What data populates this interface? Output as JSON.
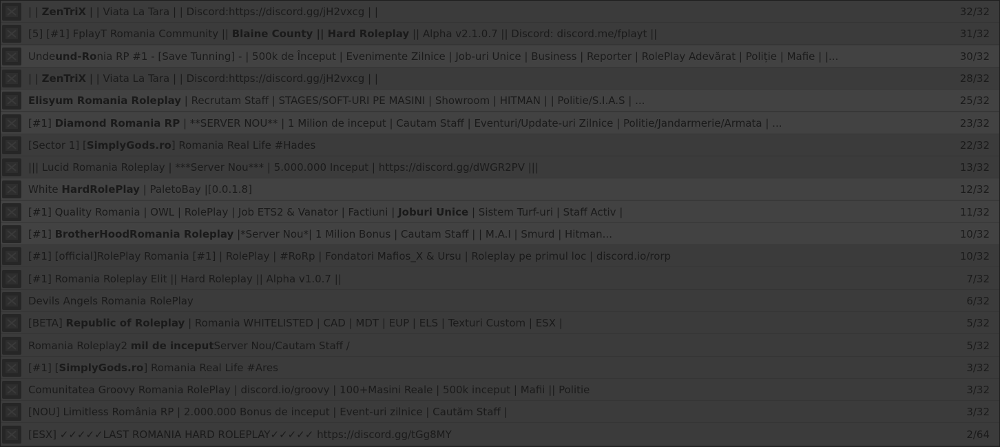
{
  "servers": [
    {
      "name_a": "| | ",
      "name_b": "ZenTriX",
      "name_c": " | | Viata La Tara | | Discord:https://discord.gg/jH2vxcg | |",
      "players": "32/32",
      "icon": "x-logo-icon"
    },
    {
      "name_a": "[5] [#1] FplayT Romania Community || ",
      "name_b": "Blaine County || Hard Roleplay",
      "name_c": " || Alpha v2.1.0.7 || Discord: discord.me/fplayt ||",
      "players": "31/32",
      "icon": "server-logo-icon"
    },
    {
      "name_a": "Unde",
      "name_b": "und-Ro",
      "name_c": "nia RP #1 - [Save Tunning] - | 500k de Început | Evenimente Zilnice | Job-uri Unice | Business | Reporter | RolePlay Adevărat | Poliție | Mafie |        |...",
      "players": "30/32",
      "icon": "circle-logo-icon"
    },
    {
      "name_a": "| | ",
      "name_b": "ZenTriX",
      "name_c": " | | Viata La Tara | | Discord:https://discord.gg/jH2vxcg | |",
      "players": "28/32",
      "icon": "x-logo-icon"
    },
    {
      "name_a": "",
      "name_b": "Elisyum Romania Roleplay",
      "name_c": " | Recrutam Staff | STAGES/SOFT-URI PE MASINI | Showroom | HITMAN | | Politie/S.I.A.S | ...",
      "players": "25/32",
      "icon": "server-logo-icon"
    },
    {
      "name_a": "[#1] ",
      "name_b": "Diamond Romania RP",
      "name_c": " | **SERVER NOU** | 1 Milion de inceput | Cautam Staff | Eventuri/Update-uri Zilnice | Politie/Jandarmerie/Armata | ...",
      "players": "23/32",
      "icon": "shield-logo-icon"
    },
    {
      "name_a": "[Sector 1] [",
      "name_b": "SimplyGods.ro",
      "name_c": "] Romania Real Life #Hades",
      "players": "22/32",
      "icon": "sector-logo-icon"
    },
    {
      "name_a": "||| Lucid Romania Roleplay | ***Server Nou*** | 5.000.000 Inceput | https://discord.gg/dWGR2PV |||",
      "name_b": "",
      "name_c": "",
      "players": "13/32",
      "icon": "server-logo-icon"
    },
    {
      "name_a": " White ",
      "name_b": "HardRolePlay",
      "name_c": " | PaletoBay |[0.0.1.8]",
      "players": "12/32",
      "icon": "server-logo-icon"
    },
    {
      "name_a": "[#1] Quality Romania | OWL | RolePlay | Job ETS2 & Vanator | Factiuni | ",
      "name_b": "Joburi Unice",
      "name_c": " | Sistem Turf-uri | Staff Activ |",
      "players": "11/32",
      "icon": "cube-logo-icon"
    },
    {
      "name_a": "[#1] ",
      "name_b": "BrotherHoodRomania Roleplay",
      "name_c": " |*Server Nou*| 1 Milion Bonus | Cautam Staff | | M.A.I | Smurd | Hitman...",
      "players": "10/32",
      "icon": "circle-logo-icon"
    },
    {
      "name_a": "[#1] [official]RolePlay Romania [#1] | RolePlay | #RoRp | Fondatori Mafios_X & Ursu | Roleplay pe primul loc | discord.io/rorp",
      "name_b": "",
      "name_c": "",
      "players": "10/32",
      "icon": "server-logo-icon"
    },
    {
      "name_a": "[#1] Romania Roleplay Elit || Hard Roleplay || Alpha v1.0.7 ||",
      "name_b": "",
      "name_c": "",
      "players": "7/32",
      "icon": "elit-logo-icon"
    },
    {
      "name_a": "Devils Angels Romania RolePlay",
      "name_b": "",
      "name_c": "",
      "players": "6/32",
      "icon": "server-logo-icon"
    },
    {
      "name_a": "      [BETA] ",
      "name_b": "Republic of Roleplay",
      "name_c": " | Romania                 WHITELISTED | CAD | MDT | EUP | ELS | Texturi Custom | ESX |",
      "players": "5/32",
      "icon": "car-logo-icon"
    },
    {
      "name_a": "      Romania Roleplay2 ",
      "name_b": "mil de inceput",
      "name_c": "Server Nou/Cautam Staff /",
      "players": "5/32",
      "icon": "server-logo-icon"
    },
    {
      "name_a": "[#1] [",
      "name_b": "SimplyGods.ro",
      "name_c": "] Romania Real Life #Ares",
      "players": "3/32",
      "icon": "sector-logo-icon"
    },
    {
      "name_a": "Comunitatea Groovy Romania RolePlay | discord.io/groovy | 100+Masini Reale | 500k inceput | Mafii || Politie",
      "name_b": "",
      "name_c": "",
      "players": "3/32",
      "icon": "server-logo-icon"
    },
    {
      "name_a": "[NOU] Limitless România RP | 2.000.000 Bonus de inceput | Event-uri zilnice | Cautăm Staff |",
      "name_b": "",
      "name_c": "",
      "players": "3/32",
      "icon": "diagonal-logo-icon"
    },
    {
      "name_a": "[ESX] ✓✓✓✓✓LAST ROMANIA HARD ROLEPLAY✓✓✓✓✓",
      "name_b": "",
      "name_c": "                                   https://discord.gg/tGg8MY",
      "players": "2/64",
      "icon": "wolf-logo-icon"
    }
  ]
}
